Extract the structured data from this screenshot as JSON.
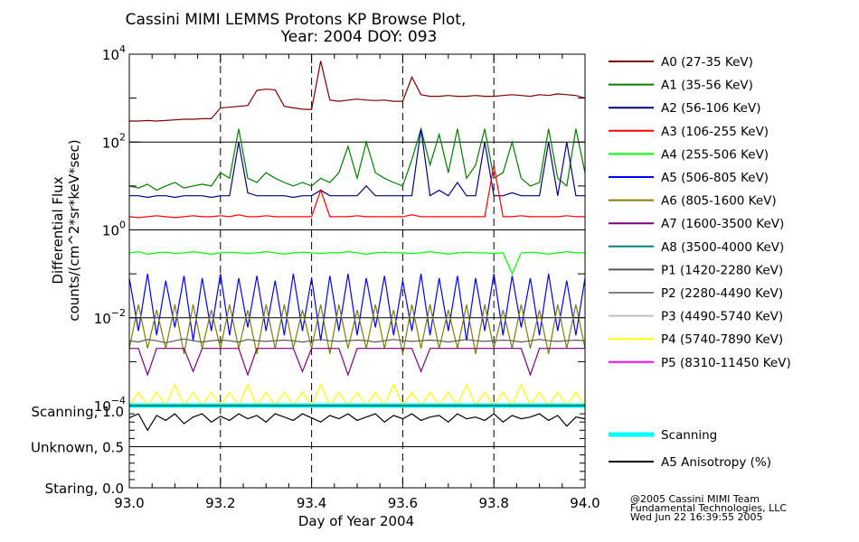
{
  "chart_data": {
    "type": "line",
    "title": "Cassini MIMI LEMMS Protons KP Browse Plot,",
    "subtitle": "Year: 2004 DOY: 093",
    "xlabel": "Day of Year 2004",
    "ylabel_line1": "Differential Flux",
    "ylabel_line2": "counts/(cm^2*sr*keV*sec)",
    "xlim": [
      93.0,
      94.0
    ],
    "x_ticks": [
      "93.0",
      "93.2",
      "93.4",
      "93.6",
      "93.8",
      "94.0"
    ],
    "x_dashed_gridlines": [
      93.2,
      93.4,
      93.6,
      93.8
    ],
    "upper_panel": {
      "yscale": "log",
      "ylim": [
        0.0001,
        10000
      ],
      "y_ticks": [
        {
          "base": "10",
          "exp": "4"
        },
        {
          "base": "10",
          "exp": "2"
        },
        {
          "base": "10",
          "exp": "0"
        },
        {
          "base": "10",
          "exp": "−2"
        },
        {
          "base": "10",
          "exp": "−4"
        }
      ],
      "grid": "horizontal at decades"
    },
    "lower_panel": {
      "ylim": [
        0.0,
        1.0
      ],
      "y_ticks": [
        "Scanning, 1.0",
        "Unknown, 0.5",
        "Staring, 0.0"
      ]
    },
    "x": [
      93.0,
      93.02,
      93.04,
      93.06,
      93.08,
      93.1,
      93.12,
      93.14,
      93.16,
      93.18,
      93.2,
      93.22,
      93.24,
      93.26,
      93.28,
      93.3,
      93.32,
      93.34,
      93.36,
      93.38,
      93.4,
      93.42,
      93.44,
      93.46,
      93.48,
      93.5,
      93.52,
      93.54,
      93.56,
      93.58,
      93.6,
      93.62,
      93.64,
      93.66,
      93.68,
      93.7,
      93.72,
      93.74,
      93.76,
      93.78,
      93.8,
      93.82,
      93.84,
      93.86,
      93.88,
      93.9,
      93.92,
      93.94,
      93.96,
      93.98,
      94.0
    ],
    "series": [
      {
        "name": "A0 (27-35 KeV)",
        "color": "#7f0000",
        "panel": "upper",
        "values": [
          300,
          300,
          310,
          300,
          310,
          320,
          330,
          330,
          340,
          340,
          600,
          620,
          650,
          680,
          1500,
          1600,
          1550,
          650,
          600,
          560,
          550,
          7000,
          900,
          850,
          900,
          950,
          900,
          880,
          900,
          850,
          850,
          3000,
          1200,
          1100,
          1100,
          1150,
          1100,
          1100,
          1150,
          1100,
          1100,
          1150,
          1200,
          1150,
          1100,
          1200,
          1150,
          1250,
          1200,
          1150,
          1000
        ]
      },
      {
        "name": "A1 (35-56 KeV)",
        "color": "#007f00",
        "panel": "upper",
        "values": [
          10,
          9,
          11,
          8,
          10,
          12,
          9,
          10,
          11,
          10,
          20,
          15,
          200,
          15,
          12,
          20,
          15,
          12,
          10,
          12,
          10,
          15,
          12,
          20,
          80,
          15,
          100,
          20,
          15,
          12,
          10,
          40,
          200,
          30,
          150,
          20,
          200,
          15,
          30,
          200,
          15,
          20,
          100,
          15,
          10,
          12,
          200,
          15,
          10,
          200,
          20
        ]
      },
      {
        "name": "A2 (56-106 KeV)",
        "color": "#00007f",
        "panel": "upper",
        "values": [
          6,
          6,
          5.5,
          6,
          6,
          5.5,
          6,
          6,
          6,
          5.5,
          6,
          6,
          100,
          7,
          6,
          6,
          6,
          6,
          5.5,
          6,
          6,
          8,
          6,
          6,
          6,
          6,
          10,
          6,
          6,
          6,
          6,
          6,
          200,
          6,
          8,
          6,
          12,
          6,
          6,
          100,
          6,
          6,
          7,
          6,
          6,
          6,
          100,
          6,
          100,
          6,
          6
        ]
      },
      {
        "name": "A3 (106-255 KeV)",
        "color": "#ff0000",
        "panel": "upper",
        "values": [
          2,
          1.9,
          2,
          2.1,
          2,
          1.9,
          2,
          2.1,
          2,
          2,
          2.1,
          2,
          2.2,
          2,
          2,
          2.1,
          2,
          2,
          2,
          2,
          2,
          8,
          2,
          2,
          2,
          2.1,
          2,
          2,
          2,
          2,
          2,
          2.2,
          2,
          2,
          2,
          2,
          2,
          2,
          2,
          2,
          30,
          2,
          2,
          2.1,
          2,
          2,
          2,
          2,
          2.1,
          2,
          2
        ]
      },
      {
        "name": "A4 (255-506 KeV)",
        "color": "#00ff00",
        "panel": "upper",
        "values": [
          0.3,
          0.32,
          0.28,
          0.3,
          0.31,
          0.29,
          0.3,
          0.32,
          0.3,
          0.28,
          0.3,
          0.31,
          0.3,
          0.29,
          0.3,
          0.32,
          0.3,
          0.28,
          0.3,
          0.31,
          0.3,
          0.29,
          0.3,
          0.3,
          0.32,
          0.3,
          0.28,
          0.3,
          0.31,
          0.3,
          0.3,
          0.29,
          0.3,
          0.32,
          0.3,
          0.28,
          0.3,
          0.31,
          0.3,
          0.3,
          0.29,
          0.3,
          0.1,
          0.3,
          0.31,
          0.3,
          0.28,
          0.3,
          0.32,
          0.3,
          0.3
        ]
      },
      {
        "name": "A5 (506-805 KeV)",
        "color": "#0000ff",
        "panel": "upper",
        "values": [
          0.08,
          0.005,
          0.1,
          0.004,
          0.07,
          0.006,
          0.09,
          0.003,
          0.08,
          0.005,
          0.1,
          0.004,
          0.08,
          0.006,
          0.09,
          0.005,
          0.07,
          0.004,
          0.1,
          0.005,
          0.08,
          0.003,
          0.09,
          0.005,
          0.1,
          0.004,
          0.08,
          0.006,
          0.09,
          0.004,
          0.07,
          0.005,
          0.1,
          0.004,
          0.08,
          0.005,
          0.09,
          0.003,
          0.08,
          0.005,
          0.1,
          0.004,
          0.09,
          0.006,
          0.08,
          0.004,
          0.1,
          0.005,
          0.07,
          0.004,
          0.08
        ]
      },
      {
        "name": "A6 (805-1600 KeV)",
        "color": "#7f7f00",
        "panel": "upper",
        "values": [
          0.002,
          0.02,
          0.002,
          0.015,
          0.002,
          0.02,
          0.0015,
          0.02,
          0.002,
          0.015,
          0.002,
          0.02,
          0.002,
          0.015,
          0.0015,
          0.02,
          0.002,
          0.02,
          0.002,
          0.015,
          0.002,
          0.02,
          0.0015,
          0.02,
          0.002,
          0.015,
          0.002,
          0.02,
          0.002,
          0.015,
          0.0015,
          0.02,
          0.002,
          0.02,
          0.002,
          0.015,
          0.002,
          0.02,
          0.0015,
          0.02,
          0.002,
          0.015,
          0.002,
          0.02,
          0.002,
          0.015,
          0.0015,
          0.02,
          0.002,
          0.02,
          0.002
        ]
      },
      {
        "name": "A7 (1600-3500 KeV)",
        "color": "#7f007f",
        "panel": "upper",
        "values": [
          0.002,
          0.002,
          0.0005,
          0.002,
          0.002,
          0.002,
          0.002,
          0.0006,
          0.002,
          0.002,
          0.002,
          0.002,
          0.002,
          0.0005,
          0.002,
          0.002,
          0.002,
          0.002,
          0.002,
          0.0006,
          0.002,
          0.002,
          0.002,
          0.002,
          0.0005,
          0.002,
          0.002,
          0.002,
          0.002,
          0.002,
          0.002,
          0.002,
          0.0006,
          0.002,
          0.002,
          0.002,
          0.002,
          0.002,
          0.002,
          0.002,
          0.002,
          0.002,
          0.002,
          0.002,
          0.0005,
          0.002,
          0.002,
          0.002,
          0.002,
          0.002,
          0.002
        ]
      },
      {
        "name": "A8 (3500-4000 KeV)",
        "color": "#007f7f",
        "panel": "upper",
        "values": []
      },
      {
        "name": "P1 (1420-2280 KeV)",
        "color": "#555555",
        "panel": "upper",
        "values": [
          0.003,
          0.0028,
          0.0032,
          0.003,
          0.0027,
          0.003,
          0.0033,
          0.003,
          0.0028,
          0.003,
          0.0031,
          0.003,
          0.0028,
          0.0032,
          0.003,
          0.0029,
          0.003,
          0.0031,
          0.003,
          0.0028,
          0.003,
          0.0032,
          0.003,
          0.0029,
          0.003,
          0.0031,
          0.003,
          0.0028,
          0.003,
          0.0032,
          0.003,
          0.0029,
          0.003,
          0.0031,
          0.003,
          0.0028,
          0.003,
          0.0032,
          0.003,
          0.0029,
          0.003,
          0.0031,
          0.003,
          0.0028,
          0.003,
          0.0032,
          0.003,
          0.0029,
          0.003,
          0.0031,
          0.003
        ]
      },
      {
        "name": "P2 (2280-4490 KeV)",
        "color": "#808080",
        "panel": "upper",
        "values": []
      },
      {
        "name": "P3 (4490-5740 KeV)",
        "color": "#c0c0c0",
        "panel": "upper",
        "values": []
      },
      {
        "name": "P4 (5740-7890 KeV)",
        "color": "#ffff00",
        "panel": "upper",
        "values": [
          0.0001,
          0.0002,
          0.0001,
          0.0002,
          0.0001,
          0.0003,
          0.0001,
          0.0002,
          0.0001,
          0.0002,
          0.0001,
          0.0002,
          0.0001,
          0.0003,
          0.0001,
          0.0002,
          0.0001,
          0.0002,
          0.0001,
          0.0002,
          0.0001,
          0.0003,
          0.0001,
          0.0002,
          0.0001,
          0.0002,
          0.0001,
          0.0002,
          0.0001,
          0.0003,
          0.0001,
          0.0002,
          0.0001,
          0.0002,
          0.0001,
          0.0002,
          0.0001,
          0.0003,
          0.0001,
          0.0002,
          0.0001,
          0.0002,
          0.0001,
          0.0003,
          0.0001,
          0.0002,
          0.0001,
          0.0002,
          0.0001,
          0.0002,
          0.0001
        ]
      },
      {
        "name": "P5 (8310-11450 KeV)",
        "color": "#ff00ff",
        "panel": "upper",
        "values": []
      },
      {
        "name": "Scanning",
        "color": "#00ffff",
        "panel": "lower",
        "thick": true,
        "values": [
          1,
          1,
          1,
          1,
          1,
          1,
          1,
          1,
          1,
          1,
          1,
          1,
          1,
          1,
          1,
          1,
          1,
          1,
          1,
          1,
          1,
          1,
          1,
          1,
          1,
          1,
          1,
          1,
          1,
          1,
          1,
          1,
          1,
          1,
          1,
          1,
          1,
          1,
          1,
          1,
          1,
          1,
          1,
          1,
          1,
          1,
          1,
          1,
          1,
          1,
          1
        ]
      },
      {
        "name": "A5 Anisotropy (%)",
        "color": "#000000",
        "panel": "lower",
        "values": [
          0.85,
          0.9,
          0.7,
          0.88,
          0.82,
          0.9,
          0.78,
          0.86,
          0.9,
          0.8,
          0.87,
          0.82,
          0.9,
          0.84,
          0.88,
          0.8,
          0.9,
          0.86,
          0.82,
          0.9,
          0.85,
          0.8,
          0.88,
          0.84,
          0.9,
          0.82,
          0.86,
          0.9,
          0.8,
          0.88,
          0.84,
          0.9,
          0.82,
          0.86,
          0.88,
          0.8,
          0.9,
          0.84,
          0.86,
          0.82,
          0.9,
          0.8,
          0.88,
          0.84,
          0.86,
          0.9,
          0.82,
          0.88,
          0.75,
          0.86,
          0.84
        ]
      }
    ]
  },
  "footer": {
    "line1": "@2005 Cassini MIMI Team",
    "line2": "Fundamental Technologies, LLC",
    "line3": "Wed Jun 22 16:39:55 2005"
  }
}
